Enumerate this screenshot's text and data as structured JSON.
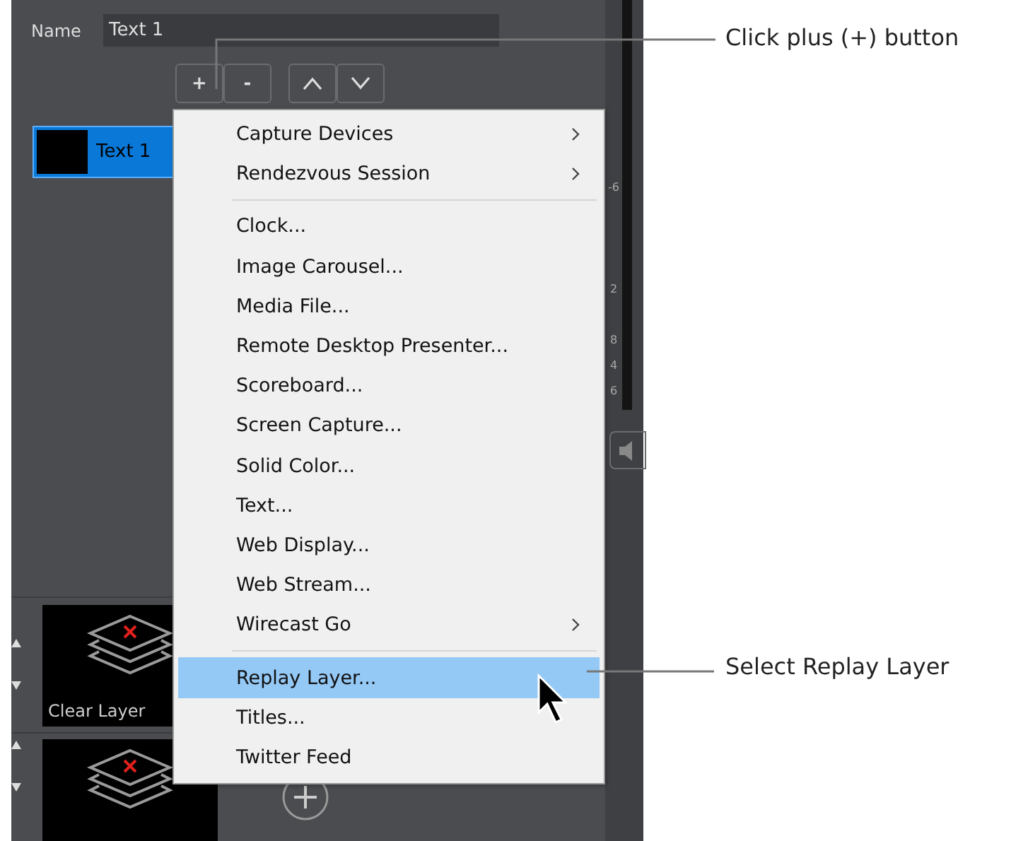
{
  "name_field": {
    "label": "Name",
    "value": "Text 1"
  },
  "layer_buttons": [
    "+",
    "-"
  ],
  "layer_list": [
    {
      "label": "Text 1",
      "selected": true
    }
  ],
  "meter_labels": [
    "-6",
    "2",
    "8",
    "4",
    "6"
  ],
  "shots": [
    {
      "kind": "layer",
      "caption": "Clear Layer"
    },
    {
      "kind": "layer"
    }
  ],
  "add_shot_button": true,
  "menu": [
    {
      "kind": "item",
      "label": "Capture Devices",
      "submenu": true,
      "selected": false
    },
    {
      "kind": "item",
      "label": "Rendezvous Session",
      "submenu": true,
      "selected": false
    },
    {
      "kind": "separator"
    },
    {
      "kind": "item",
      "label": "Clock...",
      "submenu": false,
      "selected": false
    },
    {
      "kind": "item",
      "label": "Image Carousel...",
      "submenu": false,
      "selected": false
    },
    {
      "kind": "item",
      "label": "Media File...",
      "submenu": false,
      "selected": false
    },
    {
      "kind": "item",
      "label": "Remote Desktop Presenter...",
      "submenu": false,
      "selected": false
    },
    {
      "kind": "item",
      "label": "Scoreboard...",
      "submenu": false,
      "selected": false
    },
    {
      "kind": "item",
      "label": "Screen Capture...",
      "submenu": false,
      "selected": false
    },
    {
      "kind": "item",
      "label": "Solid Color...",
      "submenu": false,
      "selected": false
    },
    {
      "kind": "item",
      "label": "Text...",
      "submenu": false,
      "selected": false
    },
    {
      "kind": "item",
      "label": "Web Display...",
      "submenu": false,
      "selected": false
    },
    {
      "kind": "item",
      "label": "Web Stream...",
      "submenu": false,
      "selected": false
    },
    {
      "kind": "item",
      "label": "Wirecast Go",
      "submenu": true,
      "selected": false
    },
    {
      "kind": "separator"
    },
    {
      "kind": "item",
      "label": "Replay Layer...",
      "submenu": false,
      "selected": true
    },
    {
      "kind": "item",
      "label": "Titles...",
      "submenu": false,
      "selected": false
    },
    {
      "kind": "item",
      "label": "Twitter Feed",
      "submenu": false,
      "selected": false
    }
  ],
  "callouts": [
    {
      "text": "Click plus (+) button"
    },
    {
      "text": "Select Replay Layer"
    }
  ]
}
